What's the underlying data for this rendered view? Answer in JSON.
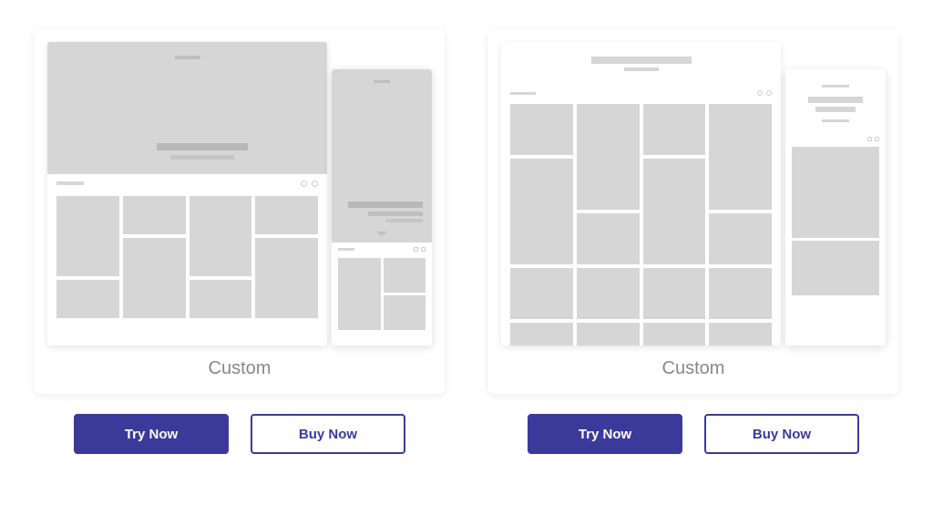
{
  "colors": {
    "brand": "#3b3a9a",
    "placeholder": "#d6d6d6"
  },
  "cards": [
    {
      "caption": "Custom",
      "try_label": "Try Now",
      "buy_label": "Buy Now"
    },
    {
      "caption": "Custom",
      "try_label": "Try Now",
      "buy_label": "Buy Now"
    }
  ]
}
